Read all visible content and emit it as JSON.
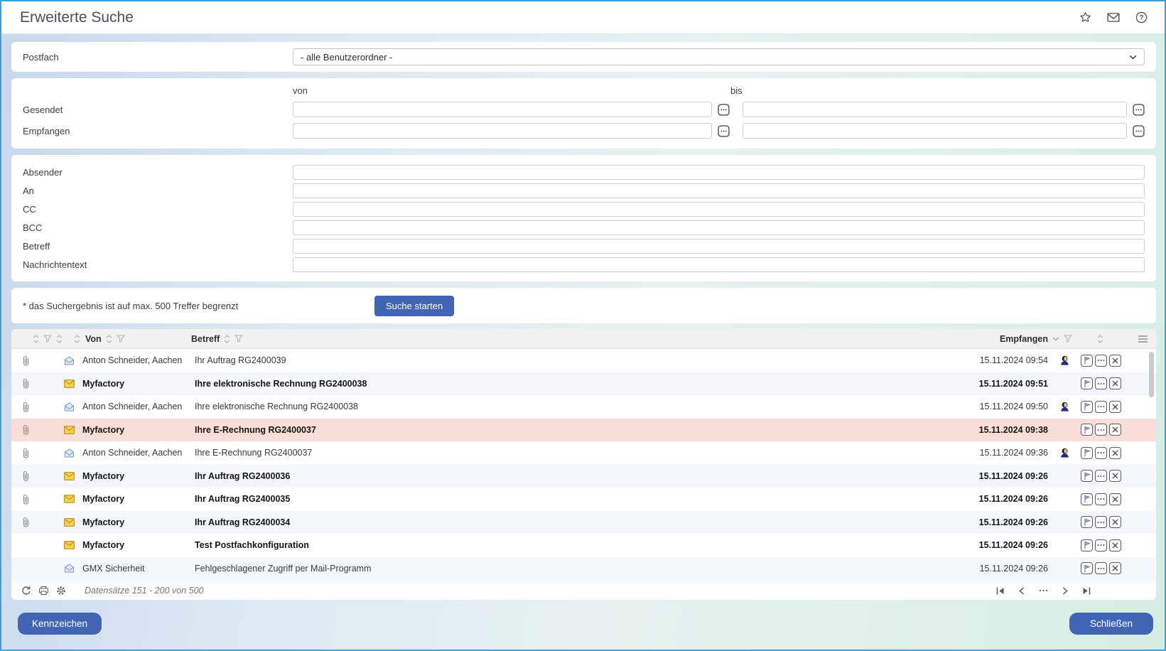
{
  "window": {
    "title": "Erweiterte Suche",
    "toolbar_icons": [
      "star-icon",
      "envelope-icon",
      "help-icon"
    ]
  },
  "search_form": {
    "postfach_label": "Postfach",
    "postfach_value": "- alle Benutzerordner -",
    "range_headers": {
      "von": "von",
      "bis": "bis"
    },
    "date_fields": [
      {
        "label": "Gesendet",
        "von_value": "",
        "bis_value": ""
      },
      {
        "label": "Empfangen",
        "von_value": "",
        "bis_value": ""
      }
    ],
    "text_fields": [
      {
        "label": "Absender",
        "value": ""
      },
      {
        "label": "An",
        "value": ""
      },
      {
        "label": "CC",
        "value": ""
      },
      {
        "label": "BCC",
        "value": ""
      },
      {
        "label": "Betreff",
        "value": ""
      },
      {
        "label": "Nachrichtentext",
        "value": ""
      }
    ],
    "limit_note": "* das Suchergebnis ist auf max. 500 Treffer begrenzt",
    "submit_label": "Suche starten"
  },
  "results": {
    "columns": {
      "von": "Von",
      "betreff": "Betreff",
      "empfangen": "Empfangen"
    },
    "rows": [
      {
        "from": "Anton Schneider, Aachen",
        "subject": "Ihr Auftrag RG2400039",
        "received": "15.11.2024 09:54",
        "unread": false,
        "attachment": true,
        "contact": true,
        "selected": false
      },
      {
        "from": "Myfactory",
        "subject": "Ihre elektronische Rechnung RG2400038",
        "received": "15.11.2024 09:51",
        "unread": true,
        "attachment": true,
        "contact": false,
        "selected": false
      },
      {
        "from": "Anton Schneider, Aachen",
        "subject": "Ihre elektronische Rechnung RG2400038",
        "received": "15.11.2024 09:50",
        "unread": false,
        "attachment": true,
        "contact": true,
        "selected": false
      },
      {
        "from": "Myfactory",
        "subject": "Ihre E-Rechnung RG2400037",
        "received": "15.11.2024 09:38",
        "unread": true,
        "attachment": true,
        "contact": false,
        "selected": true
      },
      {
        "from": "Anton Schneider, Aachen",
        "subject": "Ihre E-Rechnung RG2400037",
        "received": "15.11.2024 09:36",
        "unread": false,
        "attachment": true,
        "contact": true,
        "selected": false
      },
      {
        "from": "Myfactory",
        "subject": "Ihr Auftrag RG2400036",
        "received": "15.11.2024 09:26",
        "unread": true,
        "attachment": true,
        "contact": false,
        "selected": false
      },
      {
        "from": "Myfactory",
        "subject": "Ihr Auftrag RG2400035",
        "received": "15.11.2024 09:26",
        "unread": true,
        "attachment": true,
        "contact": false,
        "selected": false
      },
      {
        "from": "Myfactory",
        "subject": "Ihr Auftrag RG2400034",
        "received": "15.11.2024 09:26",
        "unread": true,
        "attachment": true,
        "contact": false,
        "selected": false
      },
      {
        "from": "Myfactory",
        "subject": "Test Postfachkonfiguration",
        "received": "15.11.2024 09:26",
        "unread": true,
        "attachment": false,
        "contact": false,
        "selected": false
      },
      {
        "from": "GMX Sicherheit",
        "subject": "Fehlgeschlagener Zugriff per Mail-Programm",
        "received": "15.11.2024 09:26",
        "unread": false,
        "attachment": false,
        "contact": false,
        "selected": false
      }
    ],
    "row_action_icons": [
      "flag-icon",
      "ellipsis-icon",
      "close-x-icon"
    ]
  },
  "footer": {
    "records_info": "Datensätze 151 - 200 von 500",
    "icons": [
      "refresh-icon",
      "print-icon",
      "gear-icon"
    ],
    "pager_icons": [
      "first-page-icon",
      "prev-page-icon",
      "more-pages-icon",
      "next-page-icon",
      "last-page-icon"
    ]
  },
  "dialog_buttons": {
    "flag": "Kennzeichen",
    "close": "Schließen"
  },
  "colors": {
    "accent_blue": "#4264b2",
    "window_border": "#3da0d6",
    "selected_row": "#f8ddd8",
    "alt_row": "#f3f7fb",
    "unread_envelope": "#f5cf4e"
  }
}
